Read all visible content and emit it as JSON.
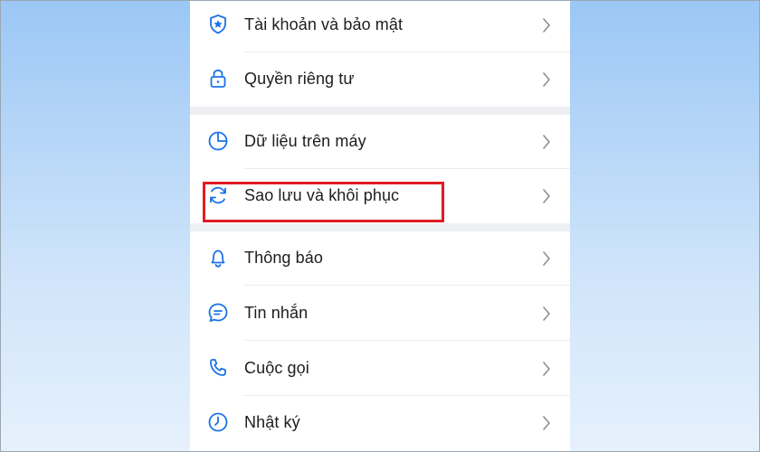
{
  "settings": {
    "items": [
      {
        "label": "Tài khoản và bảo mật",
        "icon": "shield-star-icon"
      },
      {
        "label": "Quyền riêng tư",
        "icon": "lock-icon"
      },
      {
        "label": "Dữ liệu trên máy",
        "icon": "pie-chart-icon"
      },
      {
        "label": "Sao lưu và khôi phục",
        "icon": "sync-icon"
      },
      {
        "label": "Thông báo",
        "icon": "bell-icon"
      },
      {
        "label": "Tin nhắn",
        "icon": "chat-bubble-icon"
      },
      {
        "label": "Cuộc gọi",
        "icon": "phone-icon"
      },
      {
        "label": "Nhật ký",
        "icon": "clock-icon"
      }
    ]
  },
  "colors": {
    "accent": "#1a73e8",
    "highlight": "#e01b24",
    "chevron": "#8e8e93"
  }
}
